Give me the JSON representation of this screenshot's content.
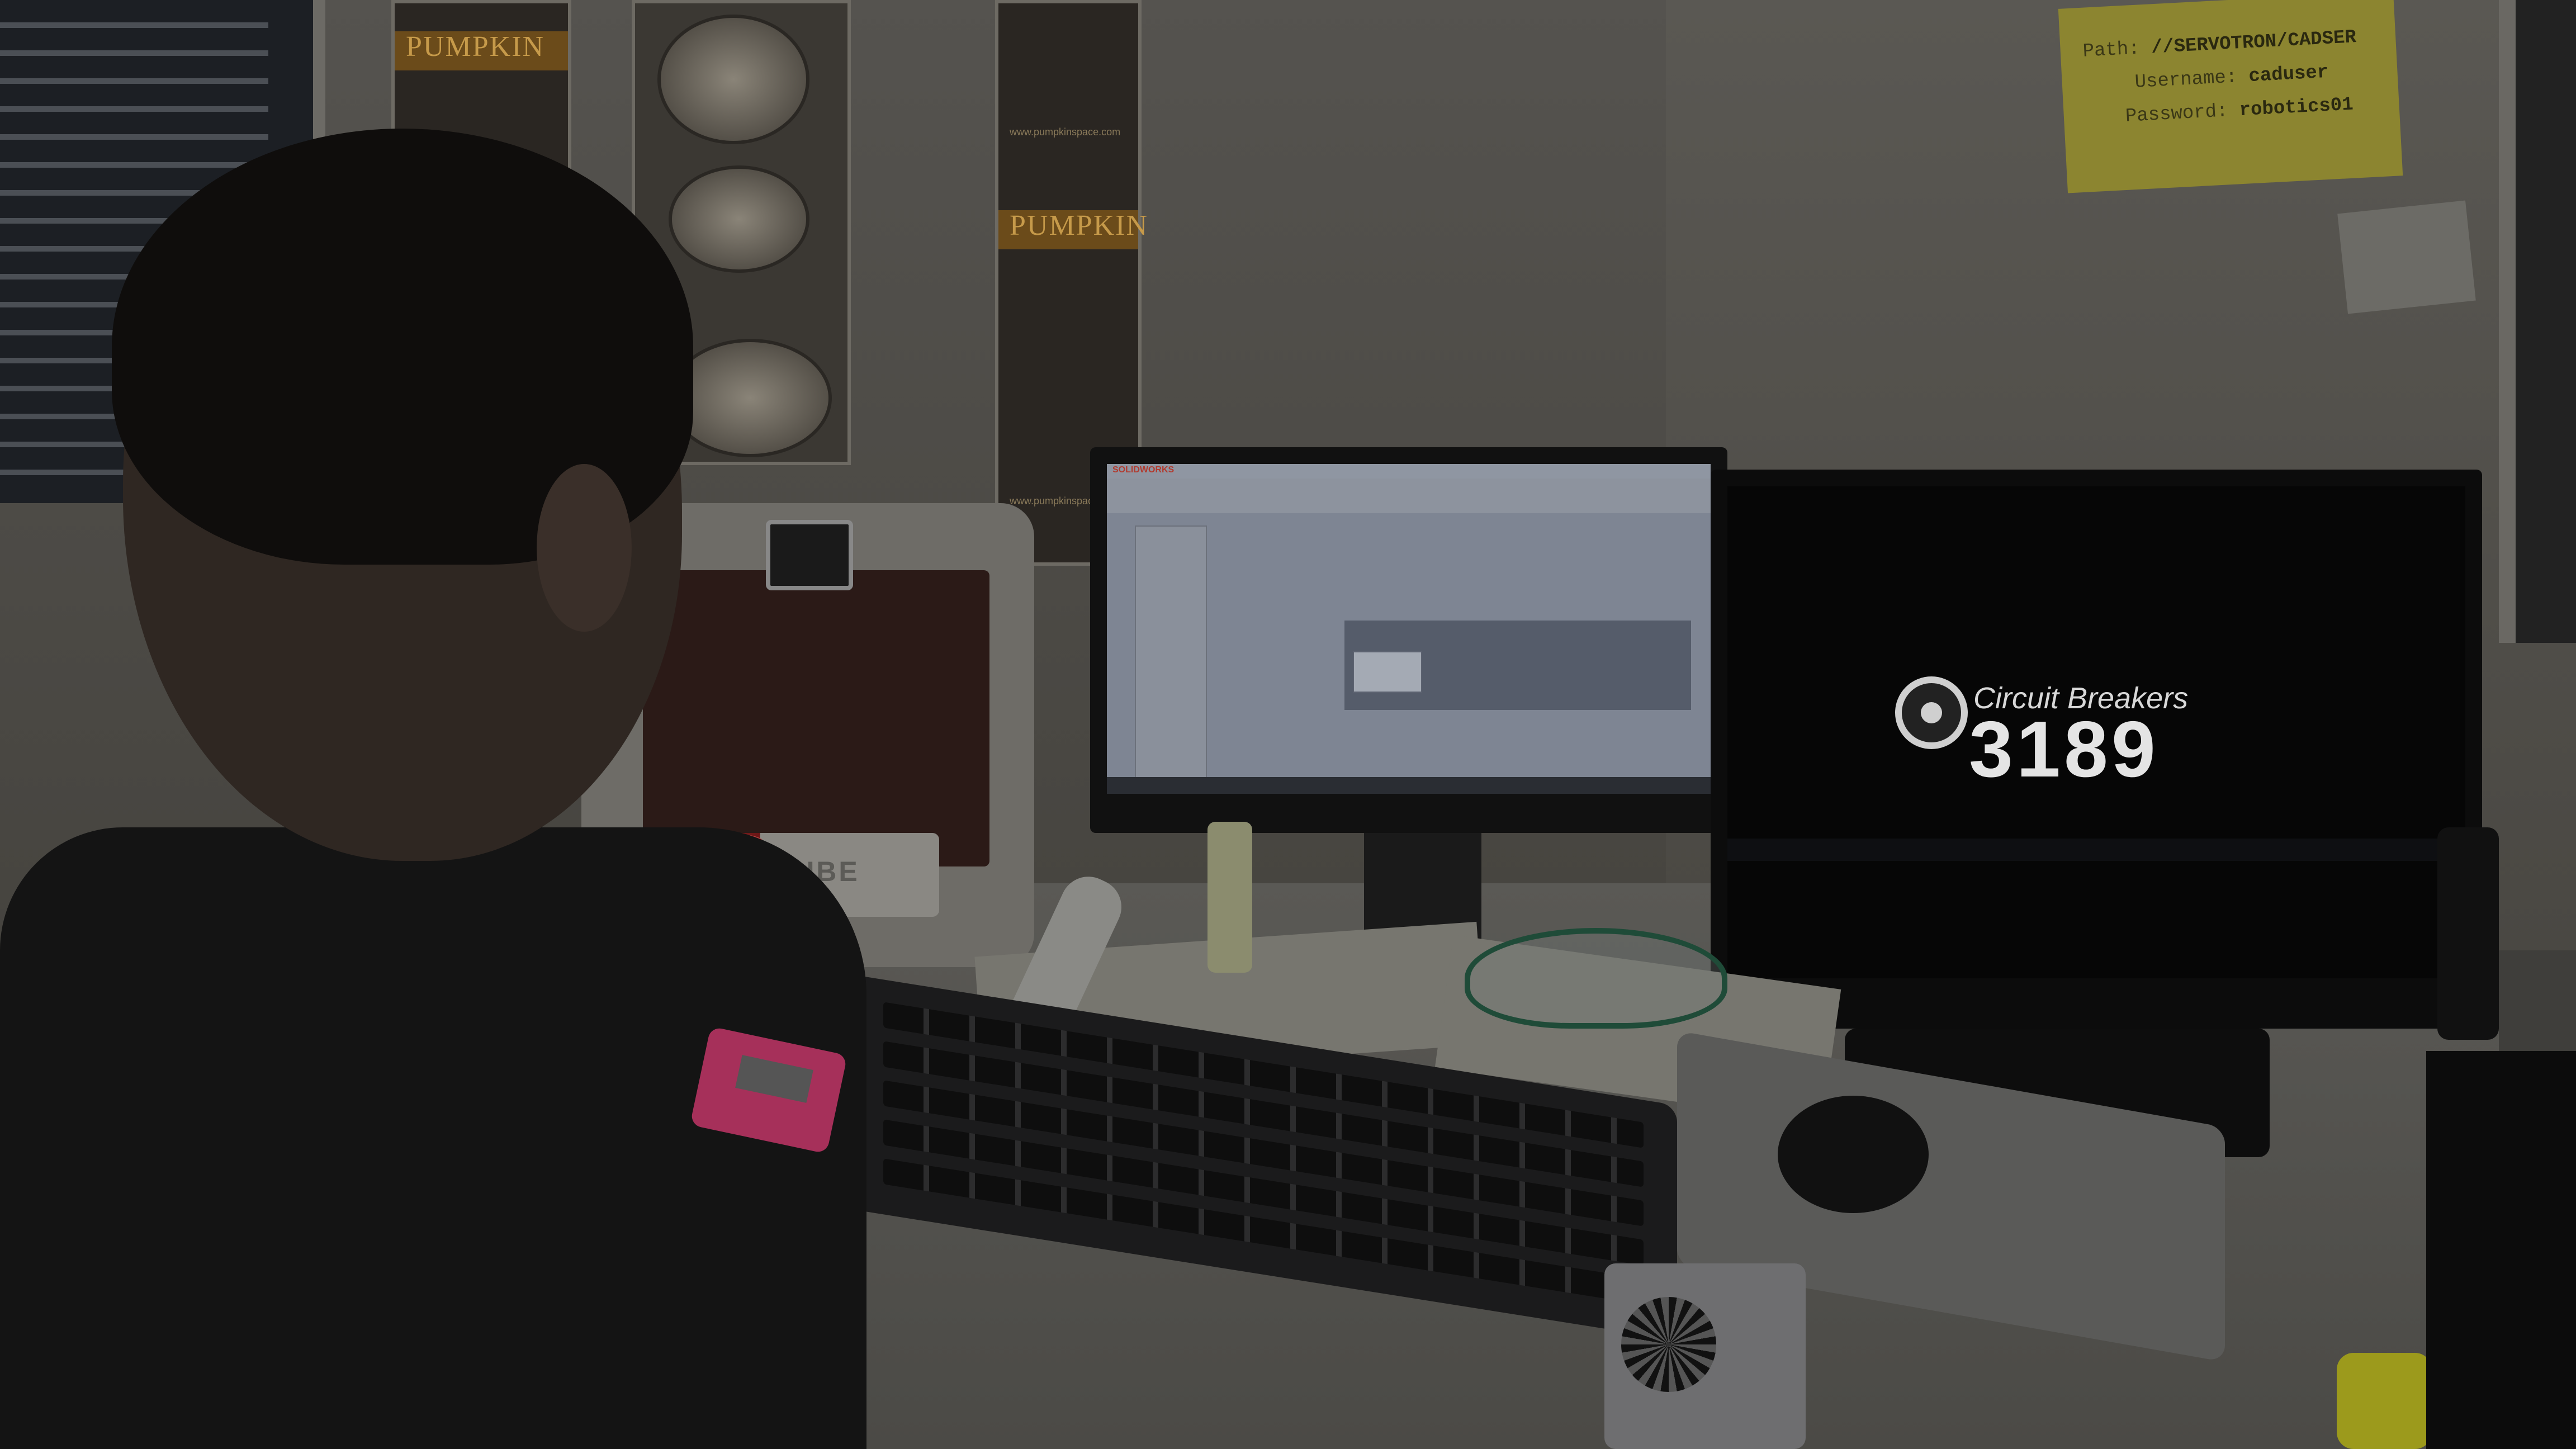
{
  "scene": {
    "description_role": "photo of a student at a CAD workstation",
    "palette": {
      "wall": "#55534f",
      "desk": "#5a5955",
      "monitor_bezel": "#111111",
      "note": "#8c8530",
      "cup": "#9a2a2a"
    }
  },
  "poster_left": {
    "brand": "PUMPKIN",
    "url": "www.pumpkinspace.com"
  },
  "poster_right": {
    "brand": "PUMPKIN",
    "url": "www.pumpkinspace.com"
  },
  "sticky_note": {
    "path_label": "Path:",
    "path_value": "//SERVOTRON/CADSER",
    "username_label": "Username:",
    "username_value": "caduser",
    "password_label": "Password:",
    "password_value": "robotics01"
  },
  "printer": {
    "brand": "CUBE"
  },
  "left_monitor": {
    "app_title": "SOLIDWORKS"
  },
  "right_monitor": {
    "team_name": "Circuit Breakers",
    "team_number": "3189"
  }
}
